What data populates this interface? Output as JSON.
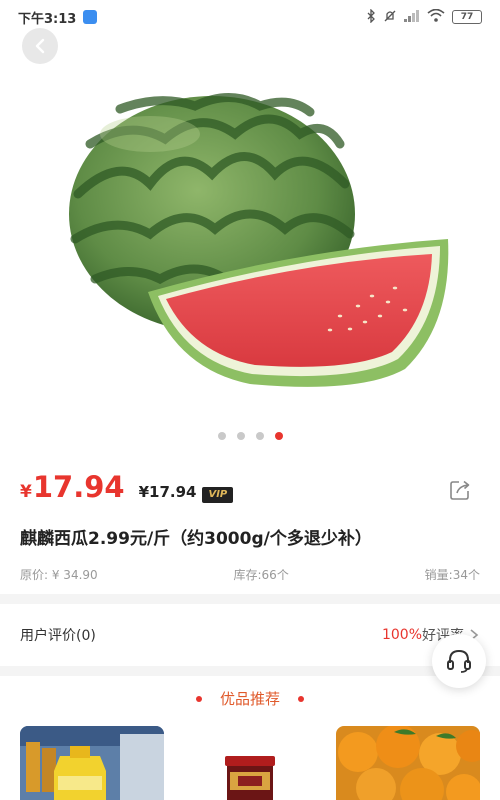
{
  "status_bar": {
    "time": "下午3:13",
    "battery": "77",
    "icons": [
      "bluetooth-icon",
      "mute-icon",
      "signal-icon",
      "wifi-icon",
      "battery-icon"
    ]
  },
  "colors": {
    "accent_red": "#e8352e",
    "recommend_orange": "#e05a2b",
    "vip_badge": "#222222"
  },
  "gallery": {
    "image": "watermelon",
    "slide_count": 4,
    "active_index": 3
  },
  "product": {
    "price_symbol": "¥",
    "price": "17.94",
    "vip_price": "¥17.94",
    "vip_badge": "VIP",
    "title": "麒麟西瓜2.99元/斤（约3000g/个多退少补）",
    "original_price": "原价: ¥ 34.90",
    "stock": "库存:66个",
    "sales": "销量:34个"
  },
  "reviews": {
    "label": "用户评价(0)",
    "positive_pct": "100%",
    "positive_label": "好评率"
  },
  "recommend": {
    "title": "优品推荐",
    "items": [
      "cooking-oil-image",
      "sauce-jar-image",
      "oranges-image"
    ]
  }
}
